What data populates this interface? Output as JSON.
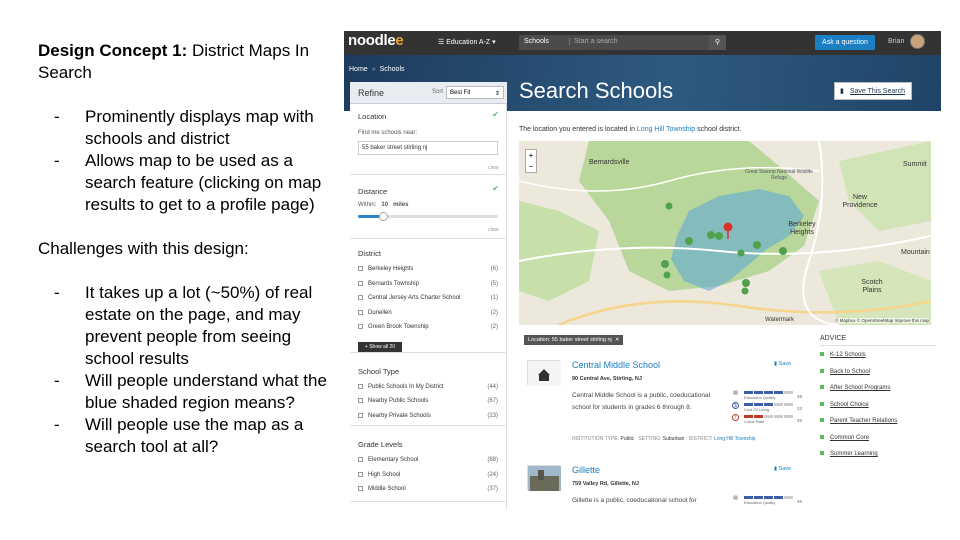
{
  "slide": {
    "title_bold": "Design Concept 1:",
    "title_rest": " District Maps In Search",
    "bullets1": [
      "Prominently displays map with schools and district",
      "Allows map to be used as a search feature (clicking on map results to get to a profile page)"
    ],
    "challenges": "Challenges with this design:",
    "bullets2": [
      "It takes up a lot (~50%) of real estate on the page, and may prevent people from seeing school results",
      "Will people understand what the blue shaded region means?",
      "Will people use the map as a search tool at all?"
    ]
  },
  "app": {
    "logo": "noodle",
    "logo_mark": "e",
    "menu": "☰ Education A-Z ▾",
    "search_select": "Schools",
    "search_placeholder": "Start a search",
    "search_icon": "search-icon",
    "ask_button": "Ask a question",
    "user_name": "Brian",
    "breadcrumb": [
      "Home",
      "Schools"
    ],
    "page_title": "Search Schools",
    "save_search": "Save This Search",
    "accent": "#1b7fc4"
  },
  "sidebar": {
    "refine": "Refine",
    "sort_label": "Sort",
    "sort_value": "Best Fit",
    "location": {
      "title": "Location",
      "hint": "Find me schools near:",
      "value": "55 baker street stirling nj",
      "clear": "clear"
    },
    "distance": {
      "title": "Distance",
      "within": "Within:",
      "value": "10",
      "unit": "miles",
      "clear": "clear",
      "level": 0.18
    },
    "district": {
      "title": "District",
      "items": [
        {
          "label": "Berkeley Heights",
          "count": "(6)"
        },
        {
          "label": "Bernards Township",
          "count": "(5)"
        },
        {
          "label": "Central Jersey Arts Charter School",
          "count": "(1)"
        },
        {
          "label": "Dunellen",
          "count": "(2)"
        },
        {
          "label": "Green Brook Township",
          "count": "(2)"
        }
      ],
      "show_all": "+ Show all 20"
    },
    "school_type": {
      "title": "School Type",
      "items": [
        {
          "label": "Public Schools In My District",
          "count": "(44)"
        },
        {
          "label": "Nearby Public Schools",
          "count": "(67)"
        },
        {
          "label": "Nearby Private Schools",
          "count": "(23)"
        }
      ]
    },
    "grade_levels": {
      "title": "Grade Levels",
      "items": [
        {
          "label": "Elementary School",
          "count": "(88)"
        },
        {
          "label": "High School",
          "count": "(24)"
        },
        {
          "label": "Middle School",
          "count": "(37)"
        }
      ]
    }
  },
  "main": {
    "note_pre": "The location you entered is located in ",
    "note_link": "Long Hill Township",
    "note_post": " school district.",
    "map": {
      "labels": [
        "Bernardsville",
        "Great Swamp National Wildlife Refuge",
        "New Providence",
        "Berkeley Heights",
        "Summit",
        "Mountain",
        "Scotch Plains"
      ],
      "attribution": "© Mapbox © OpenStreetMap Improve this map",
      "watermark": "Watermark"
    },
    "location_tag": "Location: 55 baker street stirling nj",
    "schools": [
      {
        "name": "Central Middle School",
        "address": "90 Central Ave, Stirling, NJ",
        "desc": "Central Middle School is a public, coeducational school for students in grades 6 through 8.",
        "save": "Save",
        "type_label": "INSTITUTION TYPE:",
        "type": "Public",
        "setting_label": "SETTING:",
        "setting": "Suburban",
        "district_label": "DISTRICT:",
        "district": "Long Hill Township",
        "bars": [
          {
            "label": "Education Quality",
            "value": "48"
          },
          {
            "label": "Cost Of Living",
            "value": "23"
          },
          {
            "label": "Crime Rate",
            "value": "26"
          }
        ]
      },
      {
        "name": "Gillette",
        "address": "759 Valley Rd, Gillette, NJ",
        "desc": "Gillette is a public, coeducational school for",
        "save": "Save",
        "bars": [
          {
            "label": "Education Quality",
            "value": "46"
          }
        ]
      }
    ]
  },
  "advice": {
    "title": "ADVICE",
    "links": [
      "K-12 Schools",
      "Back to School",
      "After School Programs",
      "School Choice",
      "Parent Teacher Relations",
      "Common Core",
      "Summer Learning"
    ]
  }
}
